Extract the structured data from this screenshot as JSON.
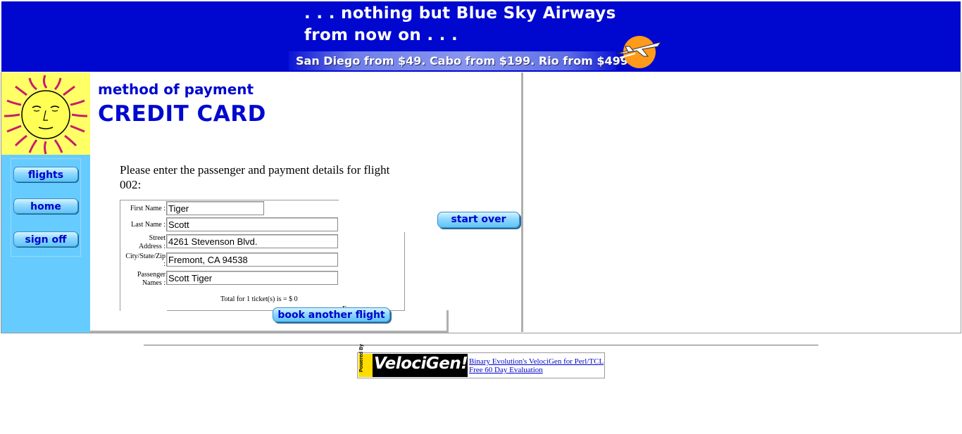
{
  "banner": {
    "slogan_line1": ". . . nothing but Blue Sky Airways",
    "slogan_line2": "from now on . . .",
    "promo": "San Diego from $49. Cabo from $199. Rio from $499."
  },
  "sidebar": {
    "flights_label": "flights",
    "home_label": "home",
    "signoff_label": "sign off"
  },
  "page": {
    "subtitle": "method of payment",
    "title": "CREDIT CARD",
    "intro": "Please enter the passenger and payment details for flight 002:"
  },
  "form": {
    "first_name_label": "First Name :",
    "first_name_value": "Tiger",
    "last_name_label": "Last Name :",
    "last_name_value": "Scott",
    "street_label_1": "Street",
    "street_label_2": "Address :",
    "street_value": "4261 Stevenson Blvd.",
    "city_label_1": "City/State/Zip",
    "city_label_2": ":",
    "city_value": "Fremont, CA 94538",
    "passenger_label_1": "Passenger",
    "passenger_label_2": "Names :",
    "passenger_value": "Scott Tiger",
    "total": "Total for 1 ticket(s) is = $ 0",
    "exp_label": "Exp"
  },
  "buttons": {
    "start_over": "start over",
    "book_another": "book another flight"
  },
  "footer": {
    "vg_powered": "Powered By",
    "vg_logo_text": "VelociGen!",
    "link1": "Binary Evolution's VelociGen for Perl/TCL",
    "link2": "Free 60 Day Evaluation"
  },
  "colors": {
    "banner_blue": "#0008cf",
    "sidebar_blue": "#66ccff",
    "sun_yellow": "#ffff66",
    "heading_blue": "#0008cf"
  },
  "icons": {
    "banner_logo": "plane-sun-icon",
    "sidebar_logo": "sun-face-icon"
  }
}
